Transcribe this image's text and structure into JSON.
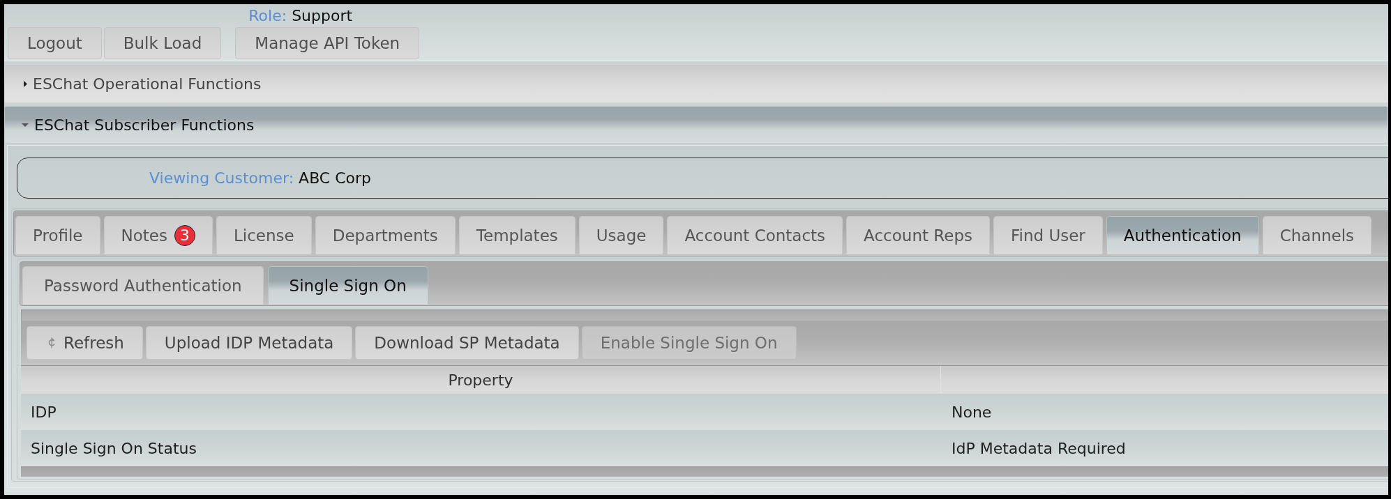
{
  "header": {
    "buttons": [
      "Logout",
      "Bulk Load"
    ],
    "role_label": "Role:",
    "role": "Support",
    "token_button": "Manage API Token"
  },
  "sections": [
    {
      "title": "ESChat Operational Functions",
      "expanded": false
    },
    {
      "title": "ESChat Subscriber Functions",
      "expanded": true,
      "content": {
        "customer": {
          "label": "Viewing Customer:",
          "value": "ABC Corp"
        },
        "tabs": [
          {
            "label": "Profile",
            "selected": false
          },
          {
            "label": "Notes",
            "badge": "3",
            "selected": false
          },
          {
            "label": "License",
            "selected": false
          },
          {
            "label": "Departments",
            "selected": false
          },
          {
            "label": "Templates",
            "selected": false
          },
          {
            "label": "Usage",
            "selected": false
          },
          {
            "label": "Account Contacts",
            "selected": false
          },
          {
            "label": "Account Reps",
            "selected": false
          },
          {
            "label": "Find User",
            "selected": false
          },
          {
            "label": "Authentication",
            "selected": true
          },
          {
            "label": "Channels",
            "selected": false
          }
        ],
        "subtabs": [
          {
            "label": "Password Authentication",
            "selected": false
          },
          {
            "label": "Single Sign On",
            "selected": true
          }
        ],
        "toolbar": [
          {
            "label": "Refresh",
            "kind": "with_icon",
            "disabled": false
          },
          {
            "label": "Upload IDP Metadata",
            "kind": "text",
            "disabled": false
          },
          {
            "label": "Download SP Metadata",
            "kind": "text",
            "disabled": false
          },
          {
            "label": "Enable Single Sign On",
            "kind": "text",
            "disabled": true
          }
        ],
        "table": {
          "columns": [
            "Property"
          ],
          "rows": [
            [
              "IDP",
              "None"
            ],
            [
              "Single Sign On Status",
              "IdP Metadata Required"
            ]
          ]
        }
      }
    }
  ]
}
